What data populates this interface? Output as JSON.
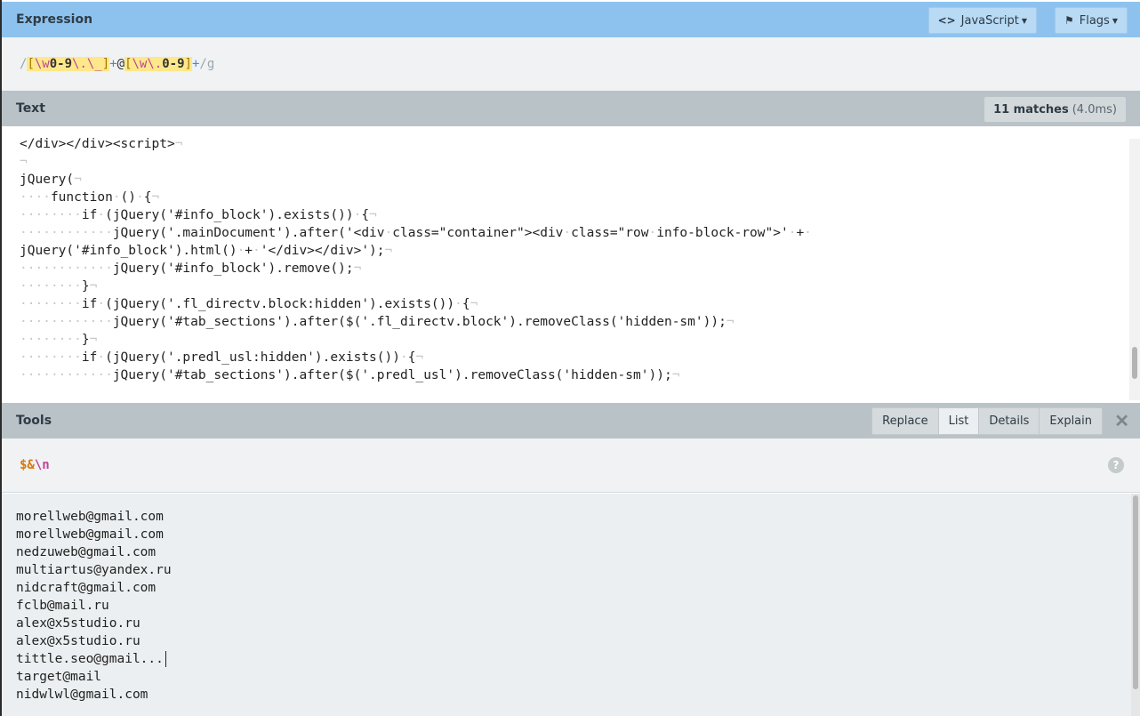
{
  "expression": {
    "title": "Expression",
    "flavor_label": "JavaScript",
    "flags_label": "Flags",
    "pattern": {
      "open_slash": "/",
      "set1_open": "[",
      "set1_w": "\\w",
      "set1_range": "0-9",
      "set1_esc1": "\\.",
      "set1_esc2": "\\_",
      "set1_close": "]",
      "plus1": "+",
      "at": "@",
      "set2_open": "[",
      "set2_w": "\\w",
      "set2_esc": "\\.",
      "set2_range": "0-9",
      "set2_close": "]",
      "plus2": "+",
      "close_flags": "/g"
    }
  },
  "text": {
    "title": "Text",
    "match_count": "11 matches",
    "match_time": "(4.0ms)",
    "lines": [
      "</div></div><script>¬",
      "¬",
      "jQuery(¬",
      "····function·()·{¬",
      "········if·(jQuery('#info_block').exists())·{¬",
      "············jQuery('.mainDocument').after('<div·class=\"container\"><div·class=\"row·info-block-row\">'·+·",
      "jQuery('#info_block').html()·+·'</div></div>');¬",
      "············jQuery('#info_block').remove();¬",
      "········}¬",
      "········if·(jQuery('.fl_directv.block:hidden').exists())·{¬",
      "············jQuery('#tab_sections').after($('.fl_directv.block').removeClass('hidden-sm'));¬",
      "········}¬",
      "········if·(jQuery('.predl_usl:hidden').exists())·{¬",
      "············jQuery('#tab_sections').after($('.predl_usl').removeClass('hidden-sm'));¬"
    ]
  },
  "tools": {
    "title": "Tools",
    "tabs": [
      "Replace",
      "List",
      "Details",
      "Explain"
    ],
    "active_tab": "List",
    "substitution_amp": "$&",
    "substitution_nl": "\\n",
    "help_label": "?",
    "close_label": "✕"
  },
  "results": [
    "morellweb@gmail.com",
    "morellweb@gmail.com",
    "nedzuweb@gmail.com",
    "multiartus@yandex.ru",
    "nidcraft@gmail.com",
    "fclb@mail.ru",
    "alex@x5studio.ru",
    "alex@x5studio.ru",
    "tittle.seo@gmail...",
    "target@mail",
    "nidwlwl@gmail.com"
  ],
  "icons": {
    "code": "code-icon",
    "flag": "flag-icon",
    "help": "help-icon",
    "close": "close-icon"
  },
  "colors": {
    "expression_header": "#8ec2ee",
    "section_header": "#b9c2c7",
    "set_highlight": "#ffe88a",
    "escape_magenta": "#c0439b",
    "quantifier_blue": "#3b8de0",
    "substitution_orange": "#d9760a"
  }
}
